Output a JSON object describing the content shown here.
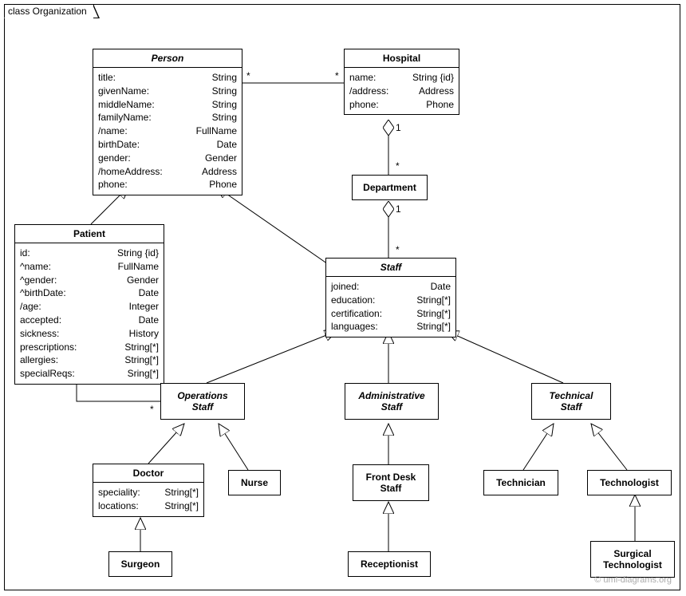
{
  "package": "class Organization",
  "watermark": "© uml-diagrams.org",
  "classes": {
    "person": {
      "name": "Person",
      "abstract": true,
      "attrs": [
        [
          "title:",
          "String"
        ],
        [
          "givenName:",
          "String"
        ],
        [
          "middleName:",
          "String"
        ],
        [
          "familyName:",
          "String"
        ],
        [
          "/name:",
          "FullName"
        ],
        [
          "birthDate:",
          "Date"
        ],
        [
          "gender:",
          "Gender"
        ],
        [
          "/homeAddress:",
          "Address"
        ],
        [
          "phone:",
          "Phone"
        ]
      ]
    },
    "hospital": {
      "name": "Hospital",
      "attrs": [
        [
          "name:",
          "String {id}"
        ],
        [
          "/address:",
          "Address"
        ],
        [
          "phone:",
          "Phone"
        ]
      ]
    },
    "department": {
      "name": "Department"
    },
    "patient": {
      "name": "Patient",
      "attrs": [
        [
          "id:",
          "String {id}"
        ],
        [
          "^name:",
          "FullName"
        ],
        [
          "^gender:",
          "Gender"
        ],
        [
          "^birthDate:",
          "Date"
        ],
        [
          "/age:",
          "Integer"
        ],
        [
          "accepted:",
          "Date"
        ],
        [
          "sickness:",
          "History"
        ],
        [
          "prescriptions:",
          "String[*]"
        ],
        [
          "allergies:",
          "String[*]"
        ],
        [
          "specialReqs:",
          "Sring[*]"
        ]
      ]
    },
    "staff": {
      "name": "Staff",
      "abstract": true,
      "attrs": [
        [
          "joined:",
          "Date"
        ],
        [
          "education:",
          "String[*]"
        ],
        [
          "certification:",
          "String[*]"
        ],
        [
          "languages:",
          "String[*]"
        ]
      ]
    },
    "opsStaff": {
      "name": "Operations Staff",
      "abstract": true,
      "twoLine": [
        "Operations",
        "Staff"
      ]
    },
    "adminStaff": {
      "name": "Administrative Staff",
      "abstract": true,
      "twoLine": [
        "Administrative",
        "Staff"
      ]
    },
    "techStaff": {
      "name": "Technical Staff",
      "abstract": true,
      "twoLine": [
        "Technical",
        "Staff"
      ]
    },
    "doctor": {
      "name": "Doctor",
      "attrs": [
        [
          "speciality:",
          "String[*]"
        ],
        [
          "locations:",
          "String[*]"
        ]
      ]
    },
    "nurse": {
      "name": "Nurse"
    },
    "frontDesk": {
      "name": "Front Desk Staff",
      "twoLine": [
        "Front Desk",
        "Staff"
      ]
    },
    "receptionist": {
      "name": "Receptionist"
    },
    "surgeon": {
      "name": "Surgeon"
    },
    "technician": {
      "name": "Technician"
    },
    "technologist": {
      "name": "Technologist"
    },
    "surgTech": {
      "name": "Surgical Technologist",
      "twoLine": [
        "Surgical",
        "Technologist"
      ]
    }
  },
  "mult": {
    "one": "1",
    "star": "*"
  }
}
